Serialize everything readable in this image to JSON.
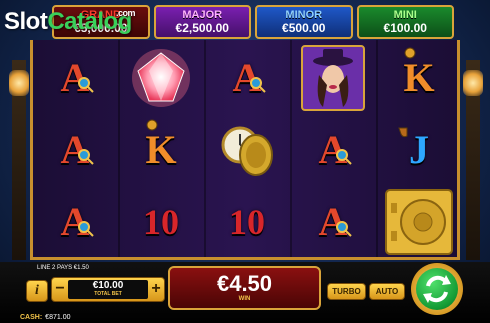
{
  "watermark": {
    "part1": "Slot",
    "part2": "Catalog",
    "suffix": ".com"
  },
  "jackpots": [
    {
      "name": "GRAND",
      "value": "€5,000.00"
    },
    {
      "name": "MAJOR",
      "value": "€2,500.00"
    },
    {
      "name": "MINOR",
      "value": "€500.00"
    },
    {
      "name": "MINI",
      "value": "€100.00"
    }
  ],
  "reels": [
    [
      "A",
      "A",
      "A"
    ],
    [
      "diamond",
      "K",
      "10"
    ],
    [
      "A",
      "pocket-watch",
      "10"
    ],
    [
      "lady-detective",
      "A",
      "A"
    ],
    [
      "K",
      "J",
      "vault"
    ]
  ],
  "paylines_text": "LINE 2 PAYS €1.50",
  "controls": {
    "info_label": "i",
    "minus_label": "−",
    "plus_label": "+",
    "bet_value": "€10.00",
    "bet_label": "TOTAL BET",
    "win_value": "€4.50",
    "win_label": "WIN",
    "turbo_label": "TURBO",
    "auto_label": "AUTO"
  },
  "cash": {
    "label": "CASH:",
    "value": "€871.00"
  },
  "colors": {
    "gold": "#d9a43a",
    "spin_green": "#139a34",
    "win_red": "#8a1010"
  }
}
